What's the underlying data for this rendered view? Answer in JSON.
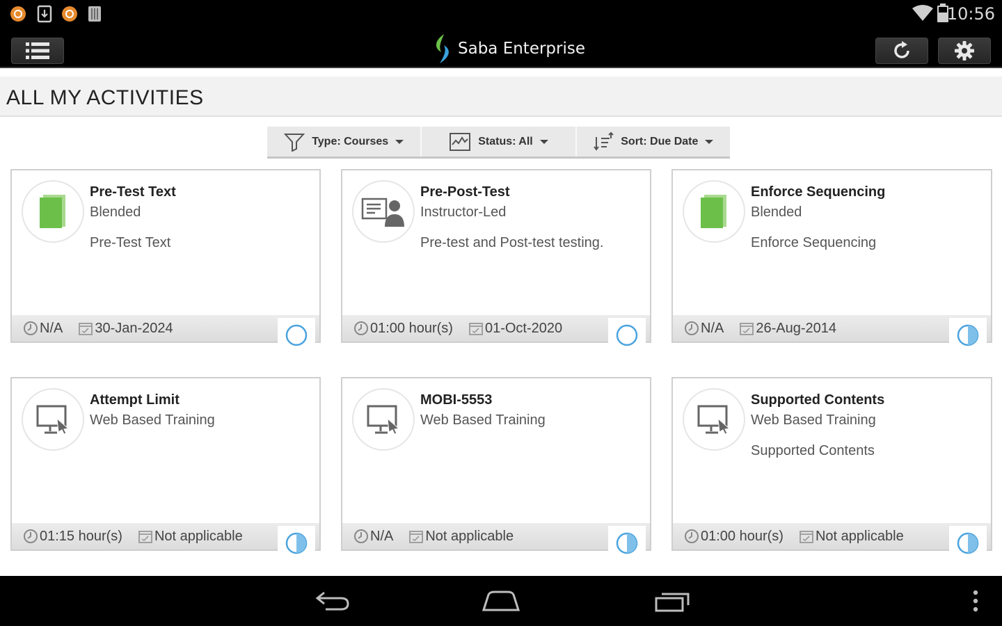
{
  "status_bar": {
    "time": "10:56",
    "notification_icons": [
      "app-notification-icon",
      "download-notification-icon",
      "app-notification-icon",
      "storage-notification-icon"
    ],
    "system_icons": [
      "wifi-icon",
      "battery-icon"
    ]
  },
  "app_bar": {
    "app_name": "Saba Enterprise",
    "menu_icon": "hamburger-menu-icon",
    "refresh_icon": "refresh-icon",
    "settings_icon": "gear-icon"
  },
  "page": {
    "title": "ALL MY ACTIVITIES"
  },
  "filters": [
    {
      "label": "Type: Courses",
      "icon": "funnel-icon"
    },
    {
      "label": "Status: All",
      "icon": "activity-chart-icon"
    },
    {
      "label": "Sort: Due Date",
      "icon": "sort-icon"
    }
  ],
  "cards": [
    {
      "title": "Pre-Test Text",
      "type": "Blended",
      "description": "Pre-Test Text",
      "icon": "book-icon",
      "duration": "N/A",
      "due_date": "30-Jan-2024",
      "progress_icon": "circle-empty-icon"
    },
    {
      "title": "Pre-Post-Test",
      "type": "Instructor-Led",
      "description": "Pre-test and Post-test testing.",
      "icon": "instructor-icon",
      "duration": "01:00 hour(s)",
      "due_date": "01-Oct-2020",
      "progress_icon": "circle-empty-icon"
    },
    {
      "title": "Enforce Sequencing",
      "type": "Blended",
      "description": "Enforce Sequencing",
      "icon": "book-icon",
      "duration": "N/A",
      "due_date": "26-Aug-2014",
      "progress_icon": "circle-half-icon"
    },
    {
      "title": "Attempt Limit",
      "type": "Web Based Training",
      "description": "",
      "icon": "monitor-icon",
      "duration": "01:15 hour(s)",
      "due_date": "Not applicable",
      "progress_icon": "circle-half-icon"
    },
    {
      "title": "MOBI-5553",
      "type": "Web Based Training",
      "description": "",
      "icon": "monitor-icon",
      "duration": "N/A",
      "due_date": "Not applicable",
      "progress_icon": "circle-half-icon"
    },
    {
      "title": "Supported Contents",
      "type": "Web Based Training",
      "description": "Supported Contents",
      "icon": "monitor-icon",
      "duration": "01:00 hour(s)",
      "due_date": "Not applicable",
      "progress_icon": "circle-half-icon"
    }
  ],
  "nav_bar": {
    "buttons": [
      "back-icon",
      "home-icon",
      "recent-apps-icon",
      "overflow-menu-icon"
    ]
  },
  "colors": {
    "bar_background": "#000000",
    "accent_green": "#6cc04a",
    "progress_blue": "#4aa3df",
    "card_footer": "#e3e3e3"
  }
}
